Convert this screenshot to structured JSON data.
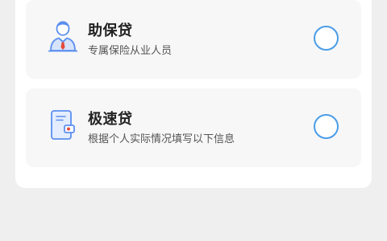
{
  "options": [
    {
      "title": "助保贷",
      "subtitle": "专属保险从业人员",
      "icon": "insurance-agent-icon",
      "selected": false
    },
    {
      "title": "极速贷",
      "subtitle": "根据个人实际情况填写以下信息",
      "icon": "fast-loan-document-icon",
      "selected": false
    }
  ],
  "colors": {
    "radio_border": "#4a9de8",
    "icon_blue": "#5b8ff0",
    "icon_red": "#e64a3b",
    "card_bg": "#ffffff",
    "option_bg": "#f7f7f7",
    "page_bg": "#efefef"
  }
}
